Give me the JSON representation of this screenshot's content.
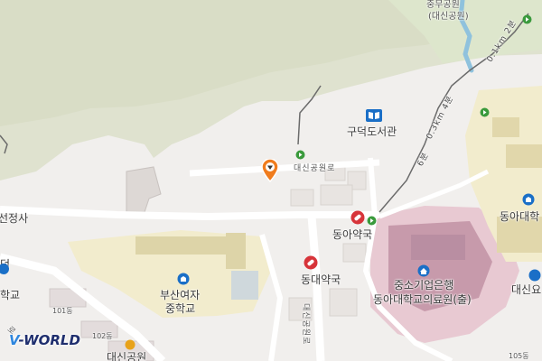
{
  "map": {
    "labels": {
      "park_line1": "충무공원",
      "park_line2": "(대신공원)",
      "library": "구덕도서관",
      "road_daesin": "대신공원로",
      "temple": "선정사",
      "pharmacy_donga": "동아약국",
      "pharmacy_dongdae": "동대약국",
      "school_line1": "부산여자",
      "school_line2": "중학교",
      "school_left": "학교",
      "left_top": "덕",
      "bank_line1": "중소기업은행",
      "bank_line2": "동아대학교의료원(출)",
      "univ_right": "동아대학",
      "right_bottom": "대신요",
      "trail_a": "0.1km 2분",
      "trail_b": "0.3km 4분",
      "trail_c": "6분",
      "bldg_101": "101동",
      "bldg_102": "102동",
      "bldg_105": "105동",
      "bottom_park": "대신공원",
      "road_vertical": "대신공원로",
      "left_edge_text": "로"
    },
    "icons": {
      "library": "book-icon",
      "pharmacy": "pill-icon",
      "school": "school-icon",
      "hospital": "hospital-icon",
      "marker": "location-pin-icon",
      "trail": "trail-marker-icon"
    },
    "colors": {
      "background": "#f1efed",
      "forest": "#dfe2cf",
      "road": "#ffffff",
      "building": "#e6e1de",
      "school_area": "#f2eccd",
      "hospital_area": "#e8c9d2",
      "hospital_building": "#b98ea2",
      "water": "#8fc2dd",
      "pharmacy": "#d7343a",
      "marker": "#f07c1d",
      "trail_icon": "#3a9a3c",
      "school_icon": "#1a6fc7"
    }
  },
  "logo": {
    "v_text": "V",
    "rest_text": "-WORLD"
  }
}
